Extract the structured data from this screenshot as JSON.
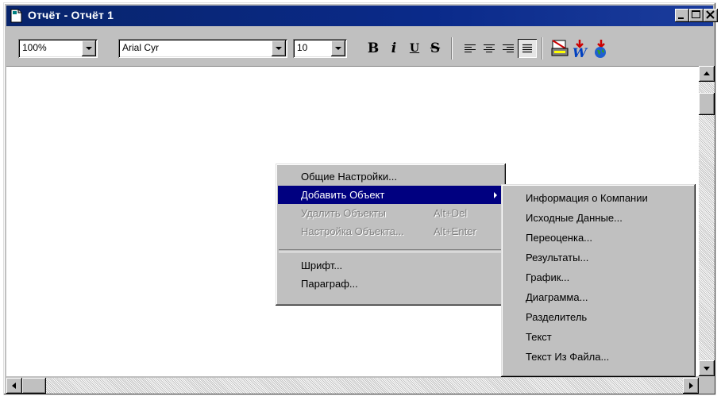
{
  "window": {
    "title": "Отчёт - Отчёт 1",
    "icon": "document-icon"
  },
  "title_buttons": [
    "minimize-icon",
    "maximize-icon",
    "close-icon"
  ],
  "toolbar": {
    "zoom": "100%",
    "font_name": "Arial Cyr",
    "font_size": "10",
    "bold": "B",
    "italic": "i",
    "underline": "U",
    "strike": "S"
  },
  "context_menu": {
    "items": [
      {
        "label": "Общие Настройки...",
        "accel": "",
        "enabled": true
      },
      {
        "label": "Добавить Объект",
        "accel": "",
        "enabled": true,
        "submenu": true,
        "highlighted": true
      },
      {
        "label": "Удалить Объекты",
        "accel": "Alt+Del",
        "enabled": false
      },
      {
        "label": "Настройка Объекта...",
        "accel": "Alt+Enter",
        "enabled": false
      },
      {
        "label": "Шрифт...",
        "accel": "",
        "enabled": true
      },
      {
        "label": "Параграф...",
        "accel": "",
        "enabled": true
      }
    ]
  },
  "submenu": {
    "items": [
      "Информация о Компании",
      "Исходные Данные...",
      "Переоценка...",
      "Результаты...",
      "График...",
      "Диаграмма...",
      "Разделитель",
      "Текст",
      "Текст Из Файла..."
    ]
  },
  "colors": {
    "title_bar": "#0a246a",
    "selection": "#000080",
    "face": "#c0c0c0"
  }
}
